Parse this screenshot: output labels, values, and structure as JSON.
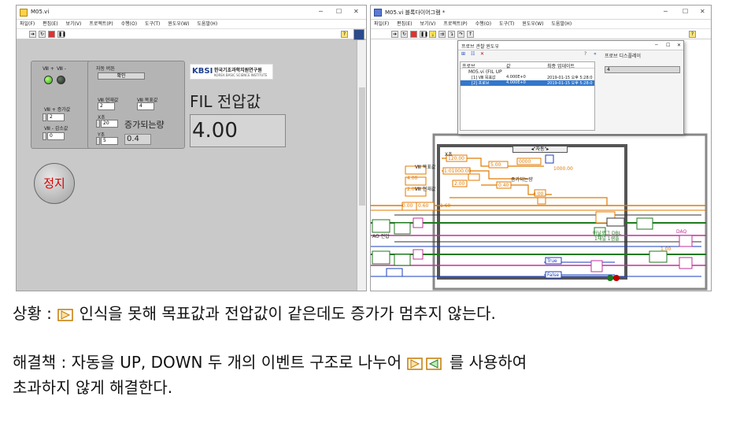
{
  "front_window": {
    "title": "M05.vi",
    "menu": [
      "파일(F)",
      "편집(E)",
      "보기(V)",
      "프로젝트(P)",
      "수행(O)",
      "도구(T)",
      "윈도우(W)",
      "도움말(H)"
    ],
    "panel": {
      "led_labels": [
        "Ⅷ +",
        "Ⅷ -"
      ],
      "up_label": "Ⅷ + 증가값",
      "up_value": "2",
      "down_label": "Ⅷ - 감소값",
      "down_value": "0",
      "auto_label": "자동 버튼",
      "auto_button": "확인",
      "current_label": "Ⅷ 현재값",
      "current_value": "2",
      "target_label": "Ⅷ 목표값",
      "target_value": "4",
      "x_label": "X초",
      "x_value": "20",
      "y_label": "Y초",
      "y_value": "5",
      "increment_label": "증가되는량",
      "increment_value": "0.4",
      "logo_mark": "KBSI",
      "logo_text_ko": "한국기초과학지원연구원",
      "logo_text_en": "KOREA BASIC SCIENCE INSTITUTE",
      "fil_label": "FIL 전압값",
      "fil_value": "4.00",
      "stop_label": "정지"
    }
  },
  "block_window": {
    "title": "M05.vi 블록다이어그램 *",
    "menu": [
      "파일(F)",
      "편집(E)",
      "보기(V)",
      "프로젝트(P)",
      "수행(O)",
      "도구(T)",
      "윈도우(W)",
      "도움말(H)"
    ],
    "probe": {
      "title": "프로브 관찰 윈도우",
      "columns": [
        "프로브",
        "값",
        "최종 업데이트"
      ],
      "group": "M05.vi (FIL UP",
      "rows": [
        {
          "name": "[1] Ⅷ 목표값",
          "value": "4.000E+0",
          "time": "2019-01-15 오후 5:28:0"
        },
        {
          "name": "[2] 프로브",
          "value": "4.000E+0",
          "time": "2019-01-15 오후 5:28:0"
        }
      ],
      "display_label": "프로브 디스플레이",
      "display_value": "4"
    },
    "case_label": "◂\"자동\"▸",
    "diagram_texts": [
      "X초",
      "120.00",
      "1:01000.00",
      "5.00",
      "0000",
      "1000.00",
      "2.00",
      "0.40",
      "증가되는량",
      "4.00",
      "4.00",
      "2.00",
      "Ⅷ 목표값",
      "Ⅷ 현재값",
      "0.00",
      "0.60",
      "1.60",
      "아날로그 DBL",
      "1채널 1샘플",
      "AO 전압",
      "DAQ",
      "1.00",
      "True",
      "False"
    ]
  },
  "caption": {
    "situation": "상황 :",
    "situation_text": "인식을 못해 목표값과 전압값이 같은데도 증가가 멈추지 않는다.",
    "solution": "해결책 : 자동을 UP, DOWN 두 개의 이벤트 구조로 나누어",
    "solution_tail": "를 사용하여",
    "solution_line2": "초과하지 않게 해결한다."
  },
  "colors": {
    "wire_orange": "#e07a00",
    "wire_green": "#1f7a1f",
    "wire_pink": "#c0309a",
    "wire_blue": "#1a3fbf",
    "probe_select": "#3377cc",
    "stop_text": "#d40000"
  },
  "icons": [
    "run-arrow-icon",
    "run-continuous-icon",
    "abort-icon",
    "pause-icon",
    "help-icon",
    "minimize-icon",
    "maximize-icon",
    "close-icon",
    "probe-add-icon",
    "probe-delete-icon"
  ]
}
